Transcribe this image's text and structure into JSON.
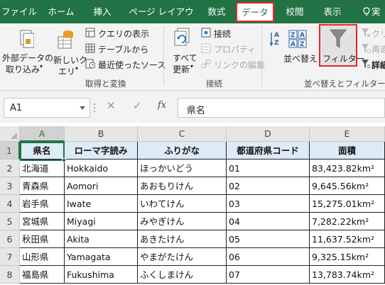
{
  "ribbon_tabs": [
    {
      "label": "ファイル",
      "active": false
    },
    {
      "label": "ホーム",
      "active": false
    },
    {
      "label": "挿入",
      "active": false
    },
    {
      "label": "ページ レイアウト",
      "active": false
    },
    {
      "label": "数式",
      "active": false
    },
    {
      "label": "データ",
      "active": true
    },
    {
      "label": "校閲",
      "active": false
    },
    {
      "label": "表示",
      "active": false
    },
    {
      "label": "実",
      "active": false
    }
  ],
  "ribbon": {
    "external_data": {
      "line1": "外部データの",
      "line2": "取り込み",
      "icon": "external-data-icon"
    },
    "new_query": {
      "line1": "新しいク",
      "line2": "エリ",
      "icon": "new-query-icon"
    },
    "show_queries": {
      "label": "クエリの表示",
      "icon": "show-queries-icon"
    },
    "from_table": {
      "label": "テーブルから",
      "icon": "table-icon"
    },
    "recent_sources": {
      "label": "最近使ったソース",
      "icon": "recent-sources-icon"
    },
    "group_get_transform": "取得と変換",
    "refresh_all": {
      "line1": "すべて",
      "line2": "更新",
      "icon": "refresh-all-icon"
    },
    "connections": {
      "label": "接続",
      "icon": "connections-icon"
    },
    "properties": {
      "label": "プロパティ",
      "icon": "properties-icon"
    },
    "edit_links": {
      "label": "リンクの編集",
      "icon": "edit-links-icon"
    },
    "group_connections": "接続",
    "sort": {
      "label": "並べ替え",
      "icon": "sort-icon"
    },
    "filter": {
      "label": "フィルター",
      "icon": "filter-icon"
    },
    "clear": {
      "label": "クリ",
      "icon": "clear-filter-icon"
    },
    "reapply": {
      "label": "再適",
      "icon": "reapply-icon"
    },
    "advanced": {
      "label": "詳細",
      "icon": "advanced-filter-icon"
    },
    "group_sort_filter": "並べ替えとフィルター"
  },
  "formula_bar": {
    "name_box": "A1",
    "cancel": "✕",
    "enter": "✓",
    "fx": "fx",
    "content": "県名"
  },
  "grid": {
    "columns": [
      "A",
      "B",
      "C",
      "D",
      "E"
    ],
    "rows": [
      "1",
      "2",
      "3",
      "4",
      "5",
      "6",
      "7",
      "8"
    ],
    "headers": [
      "県名",
      "ローマ字読み",
      "ふりがな",
      "都道府県コード",
      "面積"
    ],
    "data": [
      [
        "北海道",
        "Hokkaido",
        "ほっかいどう",
        "01",
        "83,423.82km²"
      ],
      [
        "青森県",
        "Aomori",
        "あおもりけん",
        "02",
        "9,645.56km²"
      ],
      [
        "岩手県",
        "Iwate",
        "いわてけん",
        "03",
        "15,275.01km²"
      ],
      [
        "宮城県",
        "Miyagi",
        "みやぎけん",
        "04",
        "7,282.22km²"
      ],
      [
        "秋田県",
        "Akita",
        "あきたけん",
        "05",
        "11,637.52km²"
      ],
      [
        "山形県",
        "Yamagata",
        "やまがたけん",
        "06",
        "9,325.15km²"
      ],
      [
        "福島県",
        "Fukushima",
        "ふくしまけん",
        "07",
        "13,783.74km²"
      ]
    ]
  },
  "colors": {
    "accent": "#217346",
    "highlight": "#e8262b",
    "header_fill": "#ddebf7"
  }
}
